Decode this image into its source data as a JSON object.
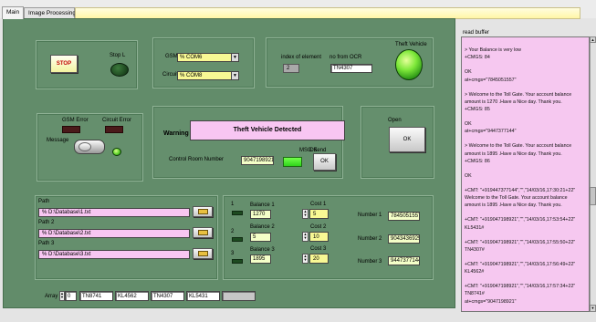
{
  "tabs": [
    {
      "label": "Main"
    },
    {
      "label": "Image Processing"
    }
  ],
  "stop_button": {
    "label": "STOP"
  },
  "stop_led": {
    "label": "Stop L"
  },
  "gsm": {
    "label": "GSM",
    "prefix": "%",
    "value": "COM6"
  },
  "circuit": {
    "label": "Circuit",
    "prefix": "%",
    "value": "COM8"
  },
  "index": {
    "label": "index of element",
    "value": "2"
  },
  "ocr": {
    "label": "no from OCR",
    "value": "TN4307"
  },
  "theft_vehicle": {
    "label": "Theft Vehicle"
  },
  "errors": {
    "gsm": "GSM Error",
    "circuit": "Circuit Error",
    "message": "Message"
  },
  "warning": {
    "label": "Warning",
    "text": "Theft Vehicle Detected"
  },
  "control_room": {
    "label": "Control Room Number",
    "value": "9047198921"
  },
  "msg_send": {
    "label": "MSG Send"
  },
  "ok_label": "OK",
  "ok_button": {
    "label": "OK"
  },
  "open": {
    "label": "Open",
    "button": "OK"
  },
  "paths": [
    {
      "label": "Path",
      "value": "D:\\Database\\1.txt"
    },
    {
      "label": "Path 2",
      "value": "D:\\Database\\2.txt"
    },
    {
      "label": "Path 3",
      "value": "D:\\Database\\3.txt"
    }
  ],
  "path_prefix": "%",
  "rows": [
    {
      "index": "1",
      "balance_label": "Balance 1",
      "balance": "1270",
      "cost_label": "Cost 1",
      "cost": "5",
      "number_label": "Number 1",
      "number": "7845051557"
    },
    {
      "index": "2",
      "balance_label": "Balance 2",
      "balance": "5",
      "cost_label": "Cost 2",
      "cost": "10",
      "number_label": "Number 2",
      "number": "9043436925"
    },
    {
      "index": "3",
      "balance_label": "Balance 3",
      "balance": "1895",
      "cost_label": "Cost 3",
      "cost": "20",
      "number_label": "Number 3",
      "number": "9447377144"
    }
  ],
  "array": {
    "label": "Array",
    "index": "0",
    "items": [
      "TN8741",
      "KL4562",
      "TN4307",
      "KL5431",
      ""
    ]
  },
  "read_buffer": {
    "label": "read buffer",
    "lines": [
      "",
      "> Your Balance is very low",
      "+CMGS: 84",
      "",
      "OK",
      "at+cmgs=\"7845051557\"",
      "",
      "> Welcome to the Toll Gate. Your account balance",
      "amount is 1270 .Have a Nice day. Thank you.",
      "+CMGS: 85",
      "",
      "OK",
      "at+cmgs=\"9447377144\"",
      "",
      "> Welcome to the Toll Gate. Your account balance",
      "amount is 1895 .Have a Nice day. Thank you.",
      "+CMGS: 86",
      "",
      "OK",
      "",
      "+CMT: \"+919447377144\",\"\",\"14/03/16,17:30:21+22\"",
      "Welcome to the Toll Gate. Your account balance",
      "amount is 1895 .Have a Nice day. Thank you.",
      "",
      "+CMT: \"+919047198921\",\"\",\"14/03/16,17:53:54+22\"",
      "KL5431#",
      "",
      "+CMT: \"+919047198921\",\"\",\"14/03/16,17:55:50+22\"",
      "TN4307#",
      "",
      "+CMT: \"+919047198921\",\"\",\"14/03/16,17:56:49+22\"",
      "KL4562#",
      "",
      "+CMT: \"+919047198921\",\"\",\"14/03/16,17:57:34+22\"",
      "TN8741#",
      "at+cmgs=\"9047198921\""
    ]
  }
}
